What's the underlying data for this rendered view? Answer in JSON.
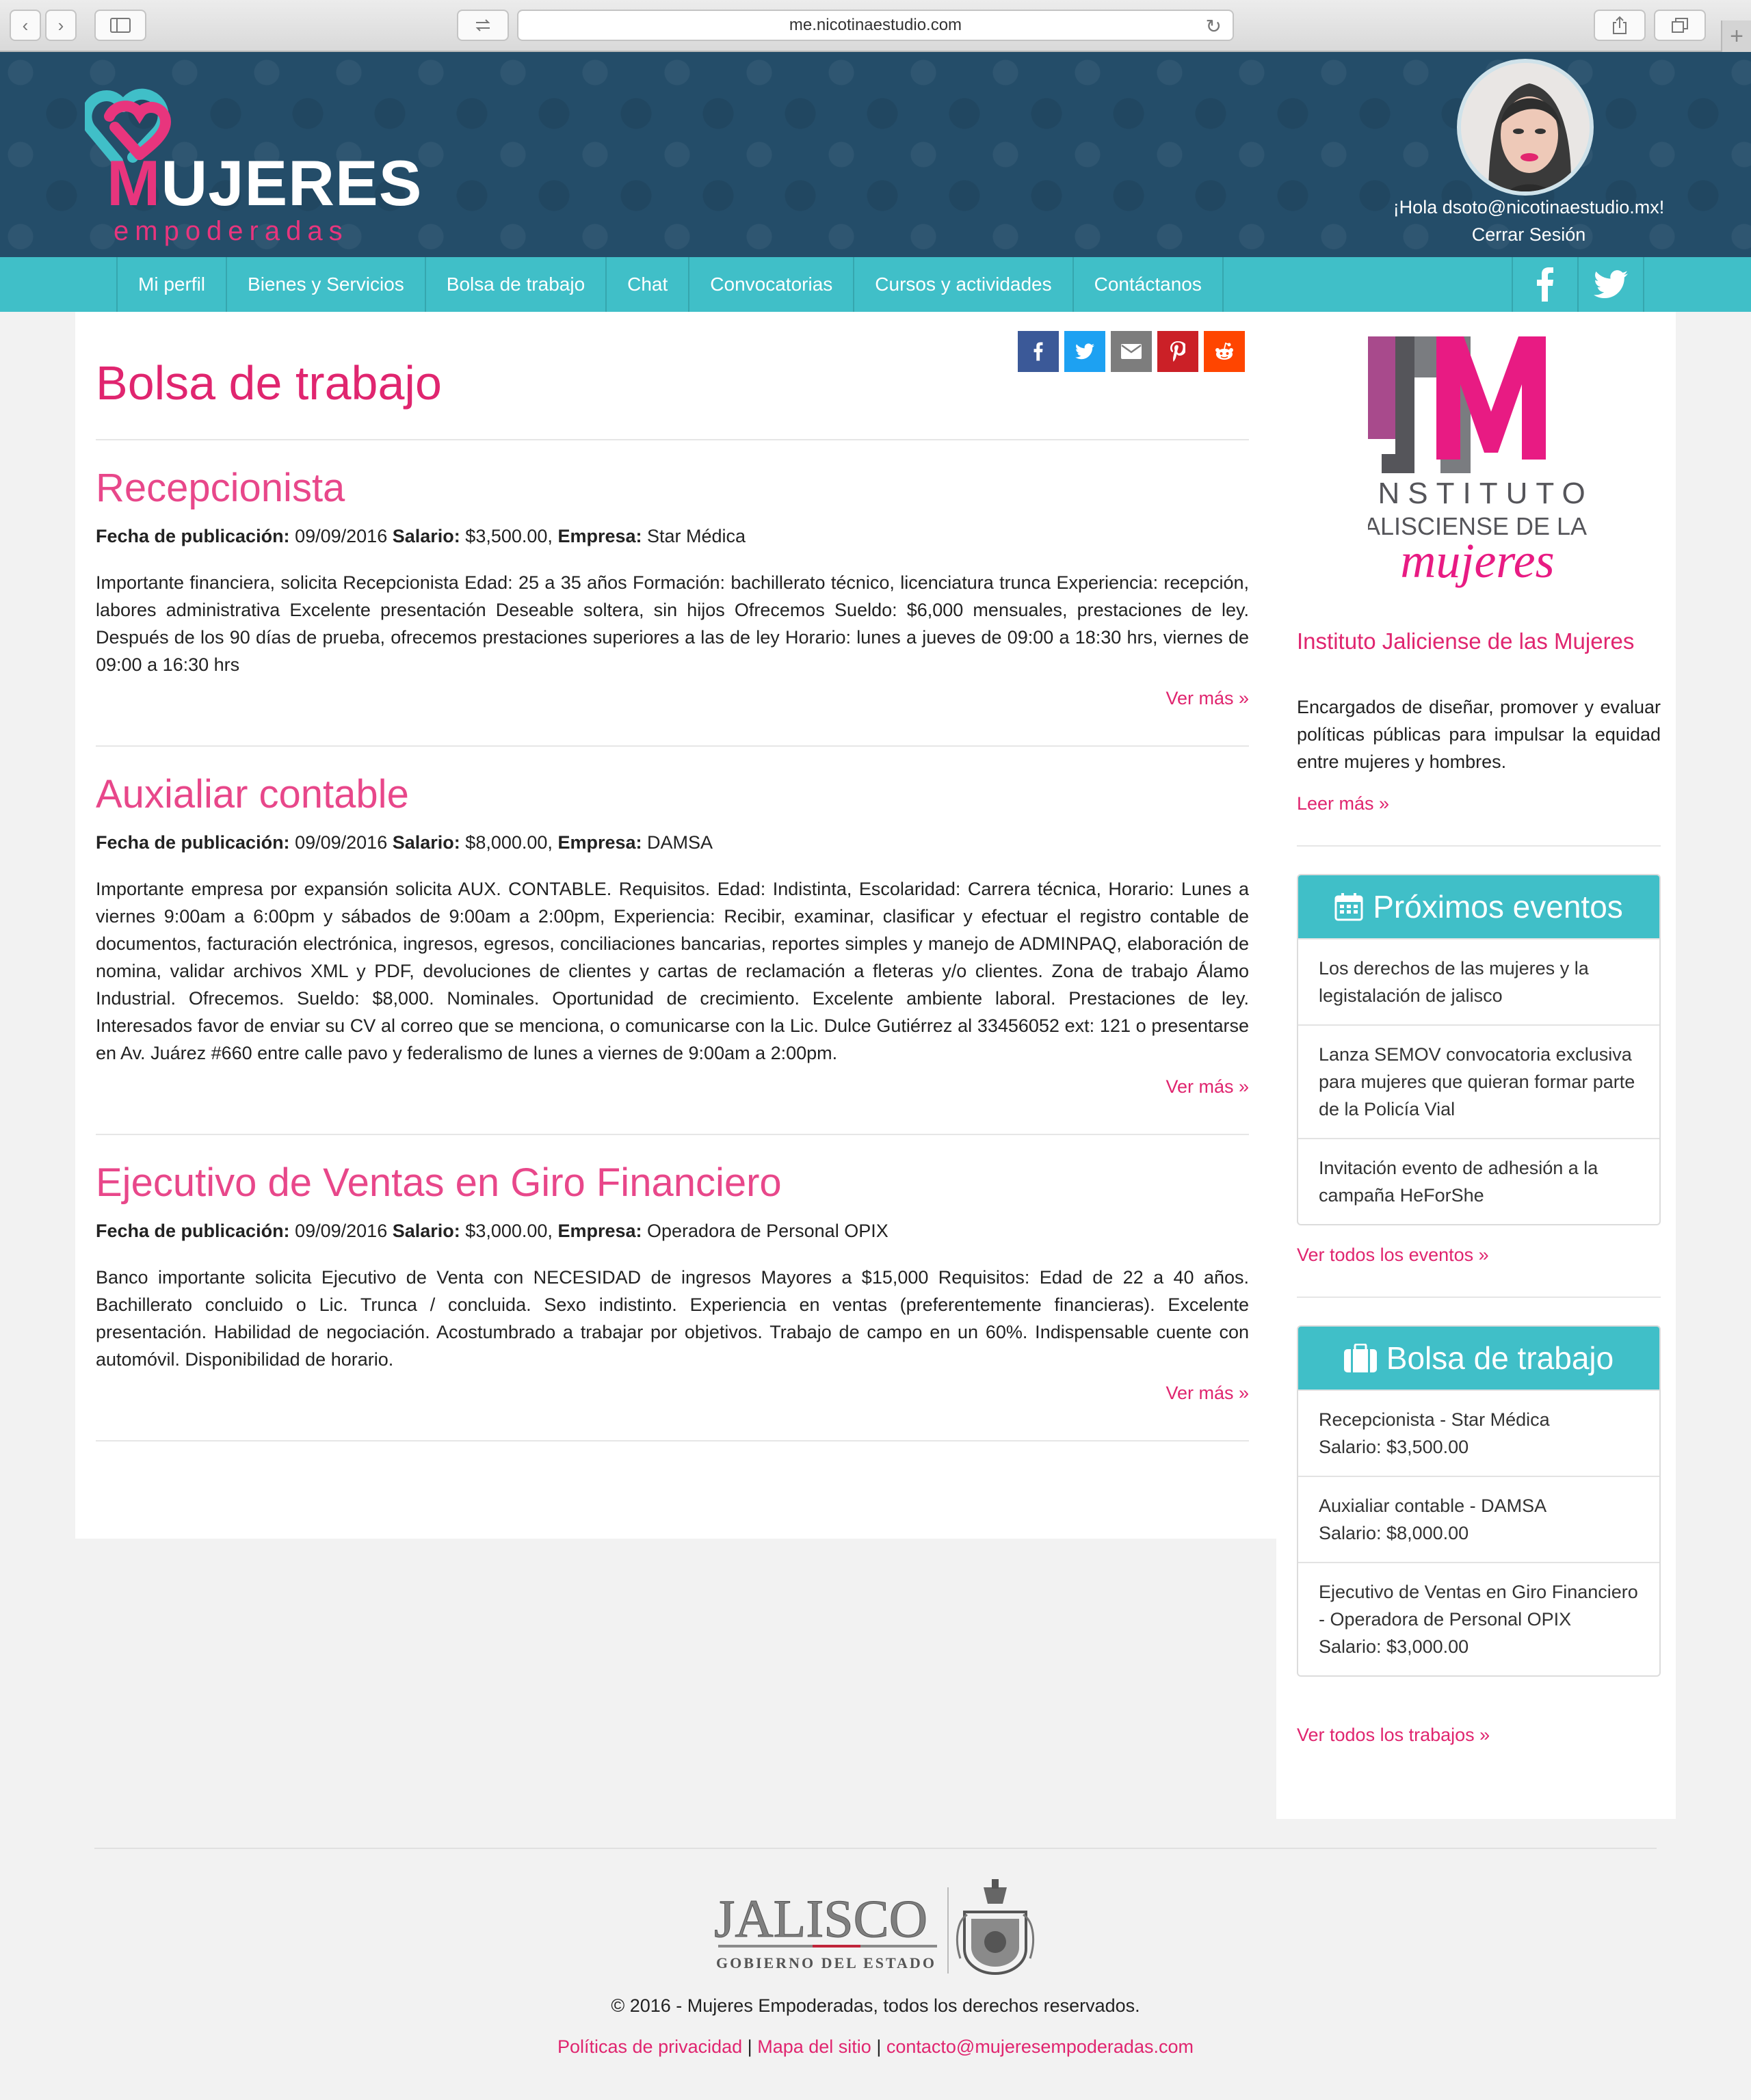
{
  "browser": {
    "url": "me.nicotinaestudio.com"
  },
  "header": {
    "logo_word": "UJERES",
    "logo_m": "M",
    "logo_sub": "empoderadas",
    "greeting": "¡Hola dsoto@nicotinaestudio.mx!",
    "logout": "Cerrar Sesión"
  },
  "nav": {
    "items": [
      {
        "label": "Mi perfil"
      },
      {
        "label": "Bienes y Servicios"
      },
      {
        "label": "Bolsa de trabajo"
      },
      {
        "label": "Chat"
      },
      {
        "label": "Convocatorias"
      },
      {
        "label": "Cursos y actividades"
      },
      {
        "label": "Contáctanos"
      }
    ],
    "social_icons": [
      "facebook-icon",
      "twitter-icon"
    ]
  },
  "share_icons": [
    "facebook-icon",
    "twitter-icon",
    "email-icon",
    "pinterest-icon",
    "reddit-icon"
  ],
  "colors": {
    "brand_pink": "#e0256f",
    "teal": "#40bfc8",
    "header_blue": "#244d69"
  },
  "main": {
    "title": "Bolsa de trabajo",
    "labels": {
      "date": "Fecha de publicación:",
      "salary": "Salario:",
      "company": "Empresa:"
    },
    "posts": [
      {
        "title": "Recepcionista",
        "date": "09/09/2016",
        "salary": "$3,500.00,",
        "company": "Star Médica",
        "body": "Importante financiera, solicita Recepcionista Edad: 25 a 35 años Formación: bachillerato técnico, licenciatura trunca Experiencia: recepción, labores administrativa Excelente presentación Deseable soltera, sin hijos Ofrecemos Sueldo: $6,000 mensuales, prestaciones de ley. Después de los 90 días de prueba, ofrecemos prestaciones superiores a las de ley Horario: lunes a jueves de 09:00 a 18:30 hrs, viernes de 09:00 a 16:30 hrs",
        "more": "Ver más »"
      },
      {
        "title": "Auxialiar contable",
        "date": "09/09/2016",
        "salary": "$8,000.00,",
        "company": "DAMSA",
        "body": "Importante empresa por expansión solicita AUX. CONTABLE. Requisitos. Edad: Indistinta, Escolaridad: Carrera técnica, Horario: Lunes a viernes 9:00am a 6:00pm y sábados de 9:00am a 2:00pm, Experiencia: Recibir, examinar, clasificar y efectuar el registro contable de documentos, facturación electrónica, ingresos, egresos, conciliaciones bancarias, reportes simples y manejo de ADMINPAQ, elaboración de nomina, validar archivos XML y PDF, devoluciones de clientes y cartas de reclamación a fleteras y/o clientes. Zona de trabajo Álamo Industrial. Ofrecemos. Sueldo: $8,000. Nominales. Oportunidad de crecimiento. Excelente ambiente laboral. Prestaciones de ley. Interesados favor de enviar su CV al correo que se menciona, o comunicarse con la Lic. Dulce Gutiérrez al 33456052 ext: 121 o presentarse en Av. Juárez #660 entre calle pavo y federalismo de lunes a viernes de 9:00am a 2:00pm.",
        "more": "Ver más »"
      },
      {
        "title": "Ejecutivo de Ventas en Giro Financiero",
        "date": "09/09/2016",
        "salary": "$3,000.00,",
        "company": "Operadora de Personal OPIX",
        "body": "Banco importante solicita Ejecutivo de Venta con NECESIDAD de ingresos Mayores a $15,000 Requisitos: Edad de 22 a 40 años. Bachillerato concluido o Lic. Trunca / concluida. Sexo indistinto. Experiencia en ventas (preferentemente financieras). Excelente presentación. Habilidad de negociación. Acostumbrado a trabajar por objetivos. Trabajo de campo en un 60%. Indispensable cuente con automóvil. Disponibilidad de horario.",
        "more": "Ver más »"
      }
    ]
  },
  "sidebar": {
    "jm_logo": {
      "line1": "INSTITUTO",
      "line2": "JALISCIENSE DE LAS",
      "line3": "mujeres"
    },
    "institute_title": "Instituto Jaliciense de las Mujeres",
    "institute_desc": "Encargados de diseñar, promover y evaluar políticas públicas para impulsar la equidad entre mujeres y hombres.",
    "read_more": "Leer más »",
    "events": {
      "title": "Próximos eventos",
      "items": [
        {
          "text": "Los derechos de las mujeres y la legistalación de jalisco"
        },
        {
          "text": "Lanza SEMOV convocatoria exclusiva para mujeres que quieran formar parte de la Policía Vial"
        },
        {
          "text": "Invitación evento de adhesión a la campaña HeForShe"
        }
      ],
      "all": "Ver todos los eventos »"
    },
    "jobs": {
      "title": "Bolsa de trabajo",
      "items": [
        {
          "name": "Recepcionista - Star Médica",
          "salary": "Salario: $3,500.00"
        },
        {
          "name": "Auxialiar contable - DAMSA",
          "salary": "Salario: $8,000.00"
        },
        {
          "name": "Ejecutivo de Ventas en Giro Financiero - Operadora de Personal OPIX",
          "salary": "Salario: $3,000.00"
        }
      ],
      "all": "Ver todos los trabajos »"
    }
  },
  "footer": {
    "jalisco_logo": {
      "word": "JALISCO",
      "sub": "GOBIERNO DEL ESTADO"
    },
    "copyright": "© 2016 - Mujeres Empoderadas, todos los derechos reservados.",
    "links": [
      "Políticas de privacidad",
      "Mapa del sitio",
      "contacto@mujeresempoderadas.com"
    ],
    "separator": "|"
  }
}
